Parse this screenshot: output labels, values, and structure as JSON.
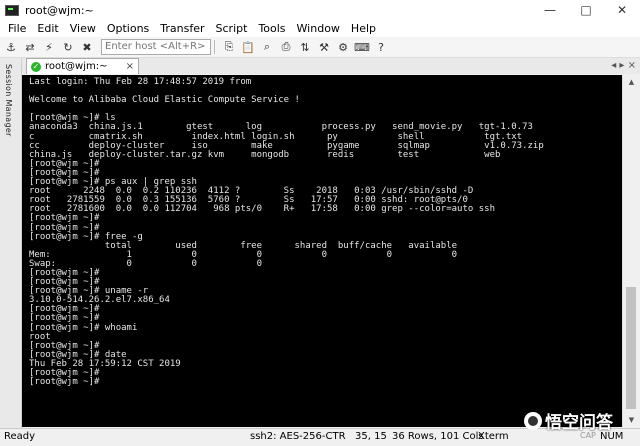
{
  "window": {
    "title": "root@wjm:~",
    "controls": [
      "minimize",
      "maximize",
      "close"
    ]
  },
  "menu": [
    "File",
    "Edit",
    "View",
    "Options",
    "Transfer",
    "Script",
    "Tools",
    "Window",
    "Help"
  ],
  "toolbar": {
    "host_placeholder": "Enter host <Alt+R>",
    "icons_left": [
      "connect-icon",
      "quick-connect-icon",
      "lightning-icon",
      "reconnect-icon",
      "disconnect-icon"
    ],
    "icons_right": [
      "copy-icon",
      "paste-icon",
      "find-icon",
      "print-icon",
      "sftp-icon",
      "tools-icon",
      "options-icon",
      "keymap-icon",
      "help-icon"
    ]
  },
  "sidebar": {
    "label": "Session Manager"
  },
  "tab": {
    "label": "root@wjm:~",
    "close": "×",
    "nav": "◂ ▸ ×"
  },
  "terminal": {
    "lines": [
      "Last login: Thu Feb 28 17:48:57 2019 from",
      "",
      "Welcome to Alibaba Cloud Elastic Compute Service !",
      "",
      "[root@wjm ~]# ls",
      "anaconda3  china.js.1        gtest      log           process.py   send_movie.py   tgt-1.0.73",
      "c          cmatrix.sh         index.html login.sh      py           shell           tgt.txt",
      "cc         deploy-cluster     iso        make          pygame       sqlmap          v1.0.73.zip",
      "china.js   deploy-cluster.tar.gz kvm     mongodb       redis        test            web",
      "[root@wjm ~]#",
      "[root@wjm ~]#",
      "[root@wjm ~]# ps aux | grep ssh",
      "root      2248  0.0  0.2 110236  4112 ?        Ss    2018   0:03 /usr/sbin/sshd -D",
      "root   2781559  0.0  0.3 155136  5760 ?        Ss   17:57   0:00 sshd: root@pts/0",
      "root   2781600  0.0  0.0 112704   968 pts/0    R+   17:58   0:00 grep --color=auto ssh",
      "[root@wjm ~]#",
      "[root@wjm ~]#",
      "[root@wjm ~]# free -g",
      "              total        used        free      shared  buff/cache   available",
      "Mem:              1           0           0           0           0           0",
      "Swap:             0           0           0",
      "[root@wjm ~]#",
      "[root@wjm ~]#",
      "[root@wjm ~]# uname -r",
      "3.10.0-514.26.2.el7.x86_64",
      "[root@wjm ~]#",
      "[root@wjm ~]#",
      "[root@wjm ~]# whoami",
      "root",
      "[root@wjm ~]#",
      "[root@wjm ~]# date",
      "Thu Feb 28 17:59:12 CST 2019",
      "[root@wjm ~]#",
      "[root@wjm ~]#"
    ]
  },
  "status": {
    "ready": "Ready",
    "ssh": "ssh2: AES-256-CTR",
    "cursor_pos": "35, 15",
    "rows_cols": "36 Rows, 101 Cols",
    "term": "Xterm",
    "cap": "CAP",
    "num": "NUM"
  },
  "watermark": "悟空问答"
}
